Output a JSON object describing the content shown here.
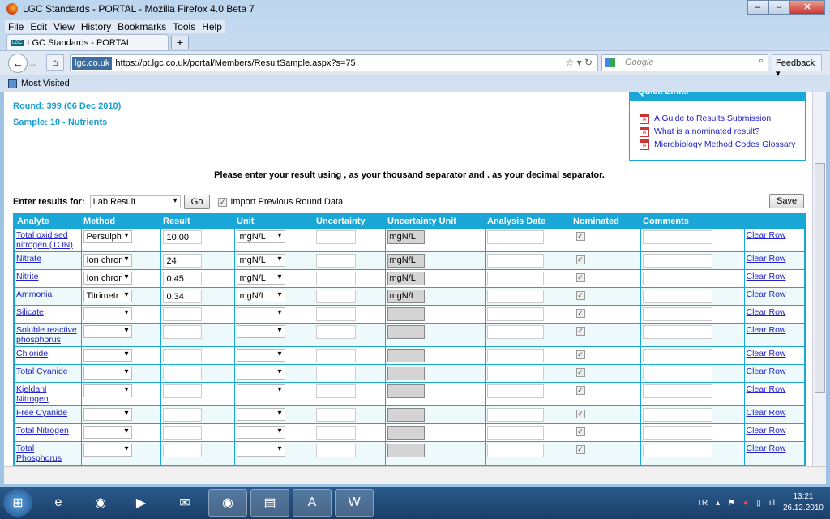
{
  "window": {
    "title": "LGC Standards - PORTAL - Mozilla Firefox 4.0 Beta 7"
  },
  "menu": [
    "File",
    "Edit",
    "View",
    "History",
    "Bookmarks",
    "Tools",
    "Help"
  ],
  "tab": {
    "label": "LGC Standards - PORTAL",
    "logo": "LGC"
  },
  "navbar": {
    "identity": "lgc.co.uk",
    "url": "https://pt.lgc.co.uk/portal/Members/ResultSample.aspx?s=75",
    "search_placeholder": "Google",
    "feedback": "Feedback"
  },
  "bookmarks": {
    "most_visited": "Most Visited"
  },
  "page": {
    "round": "Round: 399 (06 Dec 2010)",
    "sample": "Sample: 10 - Nutrients",
    "quick_links": {
      "title": "Quick Links",
      "items": [
        "A Guide to Results Submission",
        "What is a nominated result?",
        "Microbiology Method Codes Glossary"
      ]
    },
    "notice": "Please enter your result using , as your thousand separator and . as your decimal separator.",
    "enter_label": "Enter results for:",
    "enter_value": "Lab Result",
    "go": "Go",
    "import_label": "Import Previous Round Data",
    "import_checked": true,
    "save": "Save",
    "columns": [
      "Analyte",
      "Method",
      "Result",
      "Unit",
      "Uncertainty",
      "Uncertainty Unit",
      "Analysis Date",
      "Nominated",
      "Comments",
      ""
    ],
    "clear_label": "Clear Row",
    "rows": [
      {
        "analyte": "Total oxidised nitrogen (TON)",
        "method": "Persulph",
        "result": "10.00",
        "unit": "mgN/L",
        "unc_unit": "mgN/L",
        "nominated": true
      },
      {
        "analyte": "Nitrate",
        "method": "Ion chror",
        "result": "24",
        "unit": "mgN/L",
        "unc_unit": "mgN/L",
        "nominated": true
      },
      {
        "analyte": "Nitrite",
        "method": "Ion chror",
        "result": "0.45",
        "unit": "mgN/L",
        "unc_unit": "mgN/L",
        "nominated": true
      },
      {
        "analyte": "Ammonia",
        "method": "Titrimetr",
        "result": "0.34",
        "unit": "mgN/L",
        "unc_unit": "mgN/L",
        "nominated": true
      },
      {
        "analyte": "Silicate",
        "method": "",
        "result": "",
        "unit": "",
        "unc_unit": "",
        "nominated": true
      },
      {
        "analyte": "Soluble reactive phosphorus",
        "method": "",
        "result": "",
        "unit": "",
        "unc_unit": "",
        "nominated": true
      },
      {
        "analyte": "Chloride",
        "method": "",
        "result": "",
        "unit": "",
        "unc_unit": "",
        "nominated": true
      },
      {
        "analyte": "Total Cyanide",
        "method": "",
        "result": "",
        "unit": "",
        "unc_unit": "",
        "nominated": true
      },
      {
        "analyte": "Kjeldahl Nitrogen",
        "method": "",
        "result": "",
        "unit": "",
        "unc_unit": "",
        "nominated": true
      },
      {
        "analyte": "Free Cyanide",
        "method": "",
        "result": "",
        "unit": "",
        "unc_unit": "",
        "nominated": true
      },
      {
        "analyte": "Total Nitrogen",
        "method": "",
        "result": "",
        "unit": "",
        "unc_unit": "",
        "nominated": true
      },
      {
        "analyte": "Total Phosphorus",
        "method": "",
        "result": "",
        "unit": "",
        "unc_unit": "",
        "nominated": true
      }
    ]
  },
  "taskbar": {
    "lang": "TR",
    "time": "13:21",
    "date": "26.12.2010"
  },
  "colors": {
    "accent": "#1aa6d6",
    "link": "#2222cc",
    "alt_row": "#eef9fc"
  }
}
